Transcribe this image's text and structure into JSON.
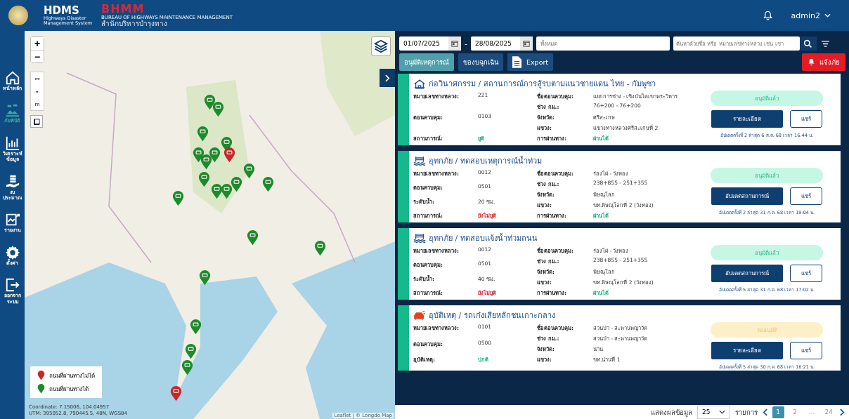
{
  "header": {
    "hdms_title": "HDMS",
    "hdms_subtitle": "Highways Disaster Management System",
    "bhmm_title": "BHMM",
    "bhmm_subtitle": "BUREAU OF HIGHWAYS MAINTENANCE MANAGEMENT",
    "bhmm_thai": "สำนักบริหารบำรุงทาง",
    "user": "admin2"
  },
  "sidebar": {
    "items": [
      {
        "kind": "home",
        "label": "หน้าหลัก",
        "selected": false
      },
      {
        "kind": "disaster",
        "label": "ภัยพิบัติ",
        "selected": true
      },
      {
        "kind": "analytics",
        "label": "วิเคราะห์ ข้อมูล",
        "selected": false
      },
      {
        "kind": "budget",
        "label": "งบ ประมาณ",
        "selected": false
      },
      {
        "kind": "report",
        "label": "รายงาน",
        "selected": false
      },
      {
        "kind": "settings",
        "label": "ตั้งค่า",
        "selected": false
      },
      {
        "kind": "logout",
        "label": "ออกจาก ระบบ",
        "selected": false
      }
    ]
  },
  "map": {
    "zoom_in": "+",
    "zoom_out": "−",
    "tools": [
      "↦",
      "▪",
      "m"
    ],
    "coordinate": "Coordinate: 7.15006, 104.04957",
    "utm": "UTM: 395052.8, 790445.5, 48N, WGS84",
    "attribution": "Leaflet | © Longdo Map",
    "legend": [
      {
        "label": "ถนนที่ผ่านทางไม่ได้",
        "color": "#c62828"
      },
      {
        "label": "ถนนที่ผ่านทางได้",
        "color": "#1e8a2c"
      }
    ],
    "pins": [
      {
        "passable": true
      },
      {
        "passable": true
      },
      {
        "passable": true
      },
      {
        "passable": true
      },
      {
        "passable": true
      },
      {
        "passable": true
      },
      {
        "passable": false
      },
      {
        "passable": true
      },
      {
        "passable": true
      },
      {
        "passable": true
      },
      {
        "passable": true
      },
      {
        "passable": true
      },
      {
        "passable": true
      },
      {
        "passable": true
      },
      {
        "passable": true
      },
      {
        "passable": true
      },
      {
        "passable": true
      },
      {
        "passable": true
      },
      {
        "passable": true
      },
      {
        "passable": true
      },
      {
        "passable": true
      },
      {
        "passable": false
      }
    ]
  },
  "filters": {
    "date_from": "01/07/2025",
    "separator": "-",
    "date_to": "28/08/2025",
    "category_placeholder": "ทั้งหมด",
    "search_placeholder": "ค้นหาด้วยชื่อ หรือ หมายเลขทางหลวง เช่น เขา"
  },
  "tabs": [
    {
      "label": "อนุมัติเหตุการณ์",
      "selected": true
    },
    {
      "label": "ของบฉุกเฉิน",
      "selected": false
    }
  ],
  "export_label": "Export",
  "alert_label": "แจ้งภัย",
  "cards": [
    {
      "kind": "building",
      "title": "ก่อวินาศกรรม / สถานการณ์การสู้รบตามแนวชายแดน ไทย - กัมพูชา",
      "left": [
        {
          "label": "หมายเลขทางหลวง:",
          "value": "221"
        },
        {
          "label": "ตอนควบคุม:",
          "value": "0103"
        },
        {
          "label": "สถานการณ์:",
          "value": "ยุติ",
          "color": "#16b07f"
        }
      ],
      "right": [
        {
          "label": "ชื่อตอนควบคุม:",
          "value": "แยกการช่าง - เชิงบันไดเขาพระวิหาร"
        },
        {
          "label": "ช่วง กม.:",
          "value": "76+200 - 76+200"
        },
        {
          "label": "จังหวัด:",
          "value": "ศรีสะเกษ"
        },
        {
          "label": "แขวง:",
          "value": "แขวงทางหลวงศรีสะเกษที่ 2"
        },
        {
          "label": "การผ่านทาง:",
          "value": "ผ่านได้",
          "color": "#16b07f"
        }
      ],
      "status": {
        "label": "อนุมัติแล้ว",
        "approved": true
      },
      "action": "รายละเอียด",
      "share": "แชร์",
      "note": "อัปเดตครั้งที่ 2 ล่าสุด 6 ส.ค. 68 เวลา 16:44 น."
    },
    {
      "kind": "flood",
      "title": "อุทกภัย / ทดสอบเหตุการณ์น้ำท่วม",
      "left": [
        {
          "label": "หมายเลขทางหลวง:",
          "value": "0012"
        },
        {
          "label": "ตอนควบคุม:",
          "value": "0501"
        },
        {
          "label": "ระดับน้ำ:",
          "value": "20 ซม."
        },
        {
          "label": "สถานการณ์:",
          "value": "ยังไม่ยุติ",
          "color": "#e0222e"
        }
      ],
      "right": [
        {
          "label": "ชื่อตอนควบคุม:",
          "value": "ร่องไผ่ - วังทอง"
        },
        {
          "label": "ช่วง กม.:",
          "value": "238+855 - 251+355"
        },
        {
          "label": "จังหวัด:",
          "value": "พิษณุโลก"
        },
        {
          "label": "แขวง:",
          "value": "ขท.พิษณุโลกที่ 2 (วังทอง)"
        },
        {
          "label": "การผ่านทาง:",
          "value": "ผ่านได้",
          "color": "#16b07f"
        }
      ],
      "status": {
        "label": "อนุมัติแล้ว",
        "approved": true
      },
      "action": "อัปเดตสถานการณ์",
      "share": "แชร์",
      "note": "อัปเดตครั้งที่ 2 ล่าสุด 31 ก.ค. 68 เวลา 19:04 น."
    },
    {
      "kind": "flood",
      "title": "อุทกภัย / ทดสอบแจ้งน้ำท่วมถนน",
      "left": [
        {
          "label": "หมายเลขทางหลวง:",
          "value": "0012"
        },
        {
          "label": "ตอนควบคุม:",
          "value": "0501"
        },
        {
          "label": "ระดับน้ำ:",
          "value": "40 ซม."
        },
        {
          "label": "สถานการณ์:",
          "value": "ยังไม่ยุติ",
          "color": "#e0222e"
        }
      ],
      "right": [
        {
          "label": "ชื่อตอนควบคุม:",
          "value": "ร่องไผ่ - วังทอง"
        },
        {
          "label": "ช่วง กม.:",
          "value": "238+855 - 251+355"
        },
        {
          "label": "จังหวัด:",
          "value": "พิษณุโลก"
        },
        {
          "label": "แขวง:",
          "value": "ขท.พิษณุโลกที่ 2 (วังทอง)"
        },
        {
          "label": "การผ่านทาง:",
          "value": "ผ่านได้",
          "color": "#16b07f"
        }
      ],
      "status": {
        "label": "อนุมัติแล้ว",
        "approved": true
      },
      "action": "อัปเดตสถานการณ์",
      "share": "แชร์",
      "note": "อัปเดตครั้งที่ 5 ล่าสุด 31 ก.ค. 68 เวลา 17:02 น."
    },
    {
      "kind": "accident",
      "title": "อุบัติเหตุ / รถเก๋งเสียหลักชนเกาะกลาง",
      "left": [
        {
          "label": "หมายเลขทางหลวง:",
          "value": "0101"
        },
        {
          "label": "ตอนควบคุม:",
          "value": "0500"
        },
        {
          "label": "อุบัติเหตุ:",
          "value": "ปกติ",
          "color": "#16b07f"
        }
      ],
      "right": [
        {
          "label": "ชื่อตอนควบคุม:",
          "value": "สวนป่า - สะพานพญาวัด"
        },
        {
          "label": "ช่วง กม.:",
          "value": "สวนป่า - สะพานพญาวัด"
        },
        {
          "label": "จังหวัด:",
          "value": "น่าน"
        },
        {
          "label": "แขวง:",
          "value": "ขท.น่านที่ 1"
        }
      ],
      "status": {
        "label": "รออนุมัติ",
        "approved": false
      },
      "action": "รายละเอียด",
      "share": "แชร์",
      "note": "อัปเดตครั้งที่ 5 ล่าสุด 30 ก.ค. 68 เวลา 16:21 น."
    }
  ],
  "pagination": {
    "label": "แสดงผลข้อมูล",
    "page_size": "25",
    "unit": "รายการ",
    "pages": [
      {
        "label": "1",
        "selected": true
      },
      {
        "label": "2",
        "selected": false
      },
      {
        "label": "…",
        "selected": false
      },
      {
        "label": "24",
        "selected": false
      }
    ]
  }
}
